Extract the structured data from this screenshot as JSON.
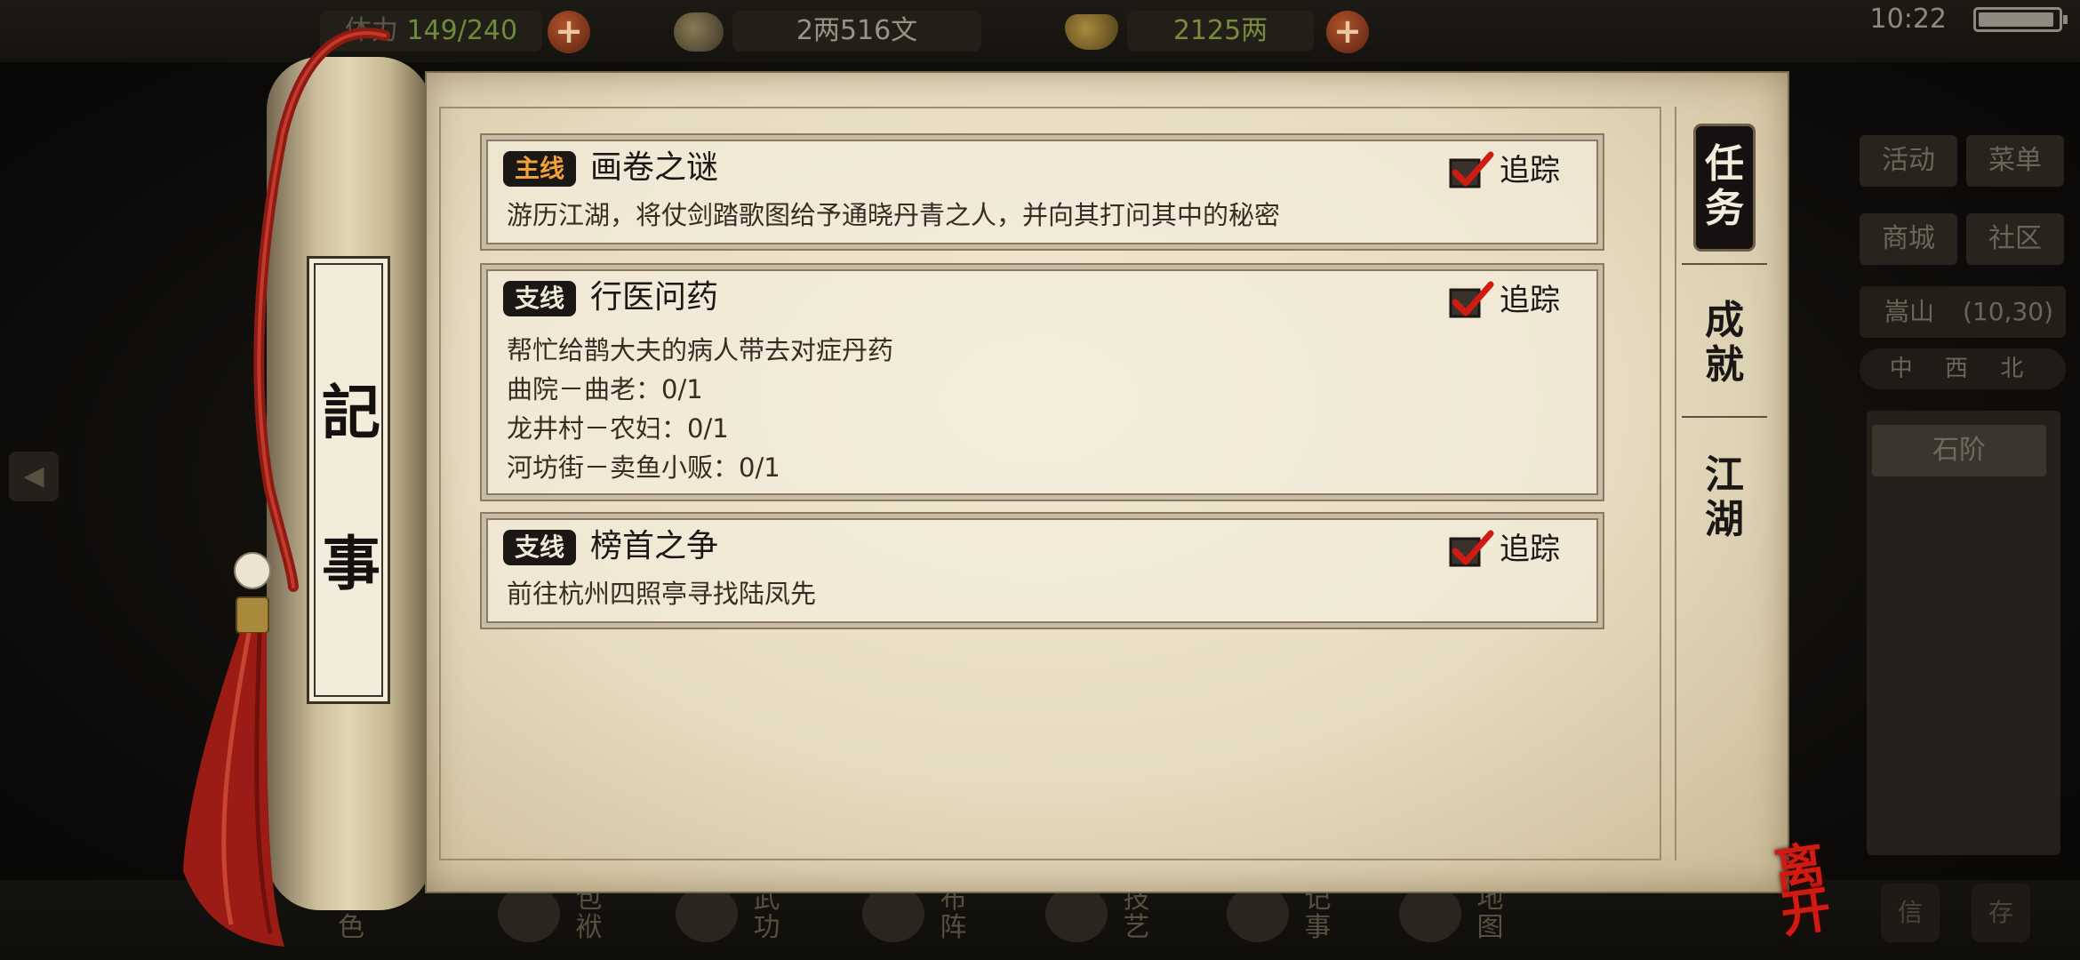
{
  "status": {
    "stamina_label": "体力",
    "stamina": "149/240",
    "silver": "2两516文",
    "gold": "2125两",
    "time": "10:22",
    "plus_symbol": "+"
  },
  "side_menu": {
    "activity": "活动",
    "menu": "菜单",
    "shop": "商城",
    "community": "社区",
    "location": "嵩山",
    "coords": "(10,30)",
    "compass": "中 西 北",
    "map_node": "石阶"
  },
  "scroll": {
    "label_top": "記",
    "label_bottom": "事"
  },
  "tabs": [
    {
      "label_1": "任",
      "label_2": "务"
    },
    {
      "label_1": "成",
      "label_2": "就"
    },
    {
      "label_1": "江",
      "label_2": "湖"
    }
  ],
  "quests": [
    {
      "badge": "主线",
      "title": "画卷之谜",
      "track_label": "追踪",
      "lines": [
        "游历江湖，将仗剑踏歌图给予通晓丹青之人，并向其打问其中的秘密"
      ]
    },
    {
      "badge": "支线",
      "title": "行医问药",
      "track_label": "追踪",
      "lines": [
        "帮忙给鹊大夫的病人带去对症丹药",
        "曲院－曲老：0/1",
        "龙井村－农妇：0/1",
        "河坊街－卖鱼小贩：0/1"
      ]
    },
    {
      "badge": "支线",
      "title": "榜首之争",
      "track_label": "追踪",
      "lines": [
        "前往杭州四照亭寻找陆凤先"
      ]
    }
  ],
  "bottom_nav": [
    {
      "label": "角色",
      "icon": "character-icon"
    },
    {
      "label": "包袱",
      "icon": "bag-icon"
    },
    {
      "label": "武功",
      "icon": "martial-arts-icon"
    },
    {
      "label": "布阵",
      "icon": "formation-icon"
    },
    {
      "label": "技艺",
      "icon": "skill-icon"
    },
    {
      "label": "记事",
      "icon": "journal-icon"
    },
    {
      "label": "地图",
      "icon": "map-icon"
    }
  ],
  "bottom_small": [
    "信",
    "存"
  ],
  "leave_label": "离开",
  "colors": {
    "paper": "#e9dfc6",
    "ink": "#1b1714",
    "main_badge": "#f0a13a",
    "check_red": "#d01b12",
    "leave_red": "#d01b12"
  }
}
